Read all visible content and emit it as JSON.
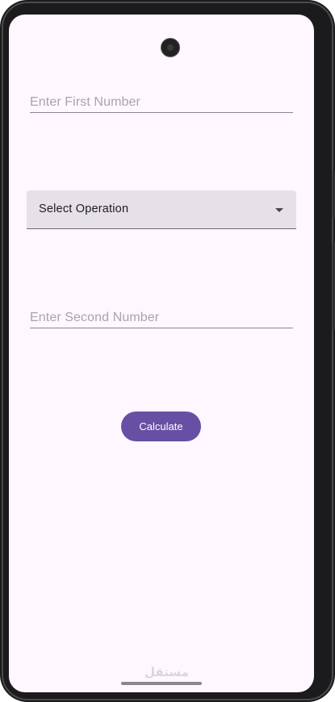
{
  "app": {
    "first_number": {
      "placeholder": "Enter First Number",
      "value": ""
    },
    "operation": {
      "selected_label": "Select Operation",
      "icon": "dropdown-arrow-icon"
    },
    "second_number": {
      "placeholder": "Enter Second Number",
      "value": ""
    },
    "calculate_button": {
      "label": "Calculate"
    }
  },
  "watermark": {
    "text": "مستقل"
  },
  "colors": {
    "background": "#fef7ff",
    "primary": "#6750a4",
    "dropdown_fill": "#e6e0e9",
    "placeholder_text": "#a8a4ab",
    "underline": "#8a8590"
  }
}
